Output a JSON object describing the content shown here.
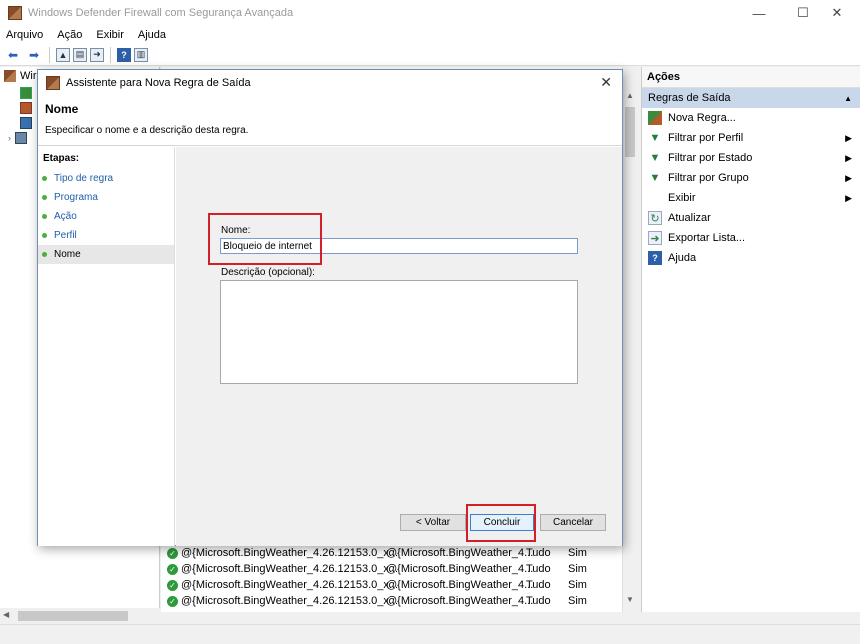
{
  "window": {
    "title": "Windows Defender Firewall com Segurança Avançada",
    "controls": {
      "minimize": "—",
      "maximize": "☐",
      "close": "✕"
    }
  },
  "menu": [
    "Arquivo",
    "Ação",
    "Exibir",
    "Ajuda"
  ],
  "tree": {
    "root_label": "Wir"
  },
  "list": {
    "rows": [
      {
        "name": "@{Microsoft.BingWeather_4.26.12153.0_x...",
        "group": "@{Microsoft.BingWeather_4...",
        "profile": "Tudo",
        "enabled": "Sim"
      },
      {
        "name": "@{Microsoft.BingWeather_4.26.12153.0_x...",
        "group": "@{Microsoft.BingWeather_4...",
        "profile": "Tudo",
        "enabled": "Sim"
      },
      {
        "name": "@{Microsoft.BingWeather_4.26.12153.0_x...",
        "group": "@{Microsoft.BingWeather_4...",
        "profile": "Tudo",
        "enabled": "Sim"
      },
      {
        "name": "@{Microsoft.BingWeather_4.26.12153.0_x...",
        "group": "@{Microsoft.BingWeather_4...",
        "profile": "Tudo",
        "enabled": "Sim"
      }
    ]
  },
  "actions": {
    "header": "Ações",
    "section": "Regras de Saída",
    "items": [
      {
        "label": "Nova Regra...",
        "icon": "new-rule-icon",
        "submenu": false
      },
      {
        "label": "Filtrar por Perfil",
        "icon": "filter-icon",
        "submenu": true
      },
      {
        "label": "Filtrar por Estado",
        "icon": "filter-icon",
        "submenu": true
      },
      {
        "label": "Filtrar por Grupo",
        "icon": "filter-icon",
        "submenu": true
      },
      {
        "label": "Exibir",
        "icon": "",
        "submenu": true
      },
      {
        "label": "Atualizar",
        "icon": "refresh-icon",
        "submenu": false
      },
      {
        "label": "Exportar Lista...",
        "icon": "export-icon",
        "submenu": false
      },
      {
        "label": "Ajuda",
        "icon": "help-icon",
        "submenu": false
      }
    ]
  },
  "dialog": {
    "title": "Assistente para Nova Regra de Saída",
    "heading": "Nome",
    "description": "Especificar o nome e a descrição desta regra.",
    "steps_header": "Etapas:",
    "steps": [
      "Tipo de regra",
      "Programa",
      "Ação",
      "Perfil",
      "Nome"
    ],
    "current_step": "Nome",
    "name_label": "Nome:",
    "name_value": "Bloqueio de internet",
    "desc_label": "Descrição (opcional):",
    "desc_value": "",
    "back_button": "< Voltar",
    "finish_button": "Concluir",
    "cancel_button": "Cancelar"
  },
  "colors": {
    "highlight": "#d21f28",
    "actions_section_bg": "#c9d7ea",
    "link": "#1f5fa8"
  }
}
